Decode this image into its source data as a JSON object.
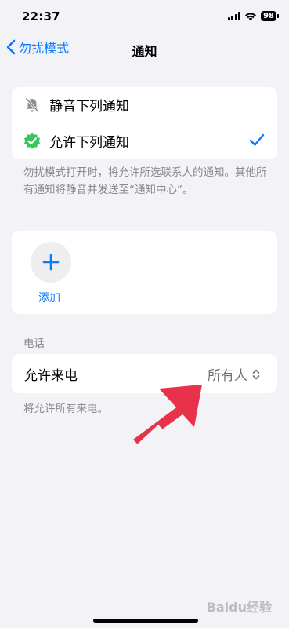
{
  "status_bar": {
    "time": "22:37",
    "battery": "98"
  },
  "nav": {
    "back_label": "勿扰模式",
    "title": "通知"
  },
  "options": [
    {
      "label": "静音下列通知",
      "icon": "bell-slash-icon",
      "selected": false
    },
    {
      "label": "允许下列通知",
      "icon": "verified-check-icon",
      "selected": true
    }
  ],
  "options_footnote": "勿扰模式打开时，将允许所选联系人的通知。其他所有通知将静音并发送至“通知中心”。",
  "add": {
    "label": "添加"
  },
  "phone": {
    "header": "电话",
    "row_label": "允许来电",
    "row_value": "所有人",
    "footnote": "将允许所有来电。"
  },
  "watermark": "Baidu经验",
  "colors": {
    "accent": "#0a7aff",
    "badge_green": "#34c759",
    "annotation_arrow": "#e8324a"
  }
}
